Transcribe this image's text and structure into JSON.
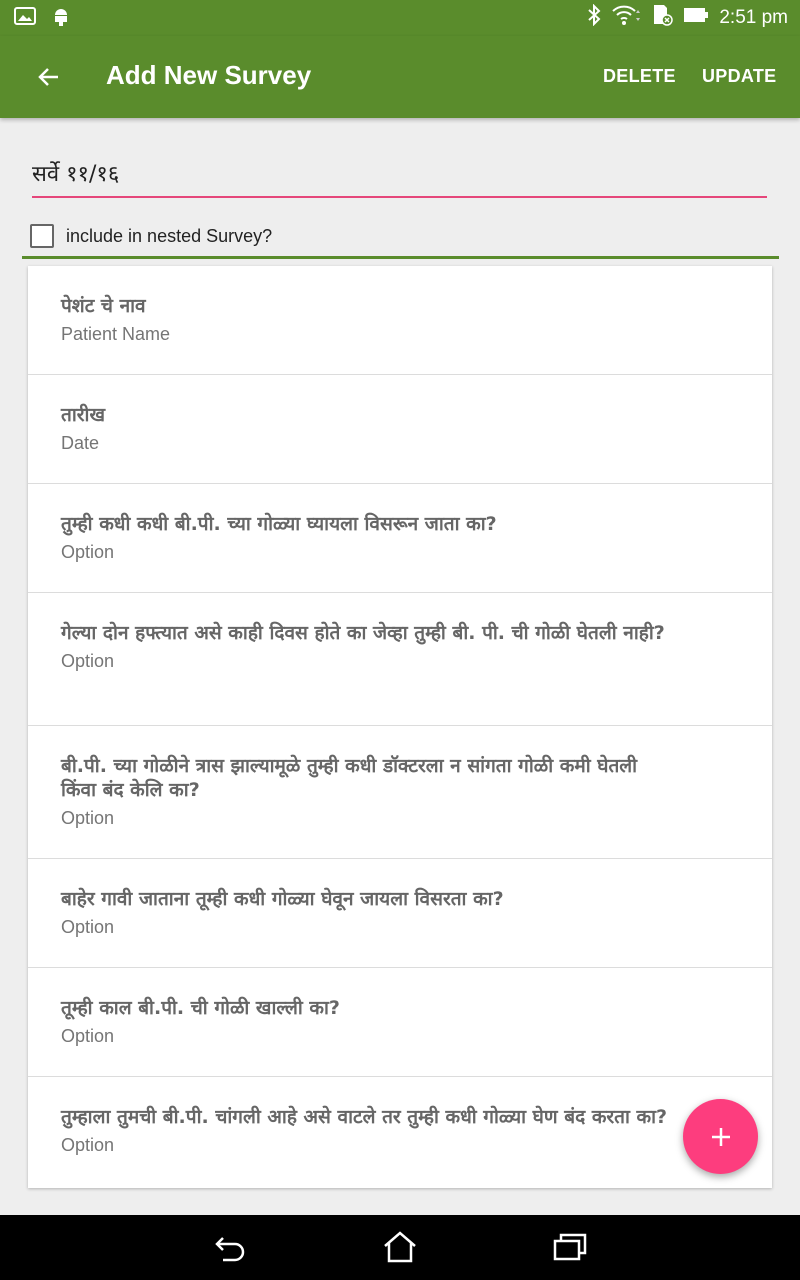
{
  "status_bar": {
    "time": "2:51 pm",
    "left_icons": [
      "image-icon",
      "android-icon"
    ],
    "right_icons": [
      "bluetooth-icon",
      "wifi-icon",
      "sd-card-icon",
      "battery-icon"
    ]
  },
  "app_bar": {
    "title": "Add New Survey",
    "delete_label": "DELETE",
    "update_label": "UPDATE",
    "color": "#5a8c2c"
  },
  "survey": {
    "title_value": "सर्वे ११/१६",
    "nested_label": "include in nested Survey?",
    "nested_checked": false
  },
  "items": [
    {
      "question": "पेशंट चे नाव",
      "subtitle": "Patient Name"
    },
    {
      "question": "तारीख",
      "subtitle": "Date"
    },
    {
      "question": "तुम्ही कधी कधी बी.पी. च्या गोळ्या घ्यायला विसरून जाता का?",
      "subtitle": "Option"
    },
    {
      "question": "गेल्या दोन हफ्त्यात असे काही दिवस होते का जेव्हा तुम्ही बी. पी. ची गोळी घेतली नाही?",
      "subtitle": "Option"
    },
    {
      "question": "बी.पी. च्या गोळीने त्रास झाल्यामूळे तुम्ही कधी डॉक्टरला न सांगता गोळी कमी घेतली किंवा बंद केलि का?",
      "subtitle": "Option"
    },
    {
      "question": "बाहेर गावी जाताना तूम्ही कधी गोळ्या घेवून जायला विसरता का?",
      "subtitle": "Option"
    },
    {
      "question": "तूम्ही काल बी.पी. ची गोळी खाल्ली का?",
      "subtitle": "Option"
    },
    {
      "question": "तुम्हाला तुमची बी.पी. चांगली आहे असे वाटले तर तुम्ही कधी गोळ्या घेण बंद करता का?",
      "subtitle": "Option"
    }
  ],
  "fab": {
    "icon": "plus-icon",
    "color": "#fd3d7e"
  },
  "nav_bar": {
    "icons": [
      "back-nav-icon",
      "home-icon",
      "recents-icon"
    ]
  }
}
